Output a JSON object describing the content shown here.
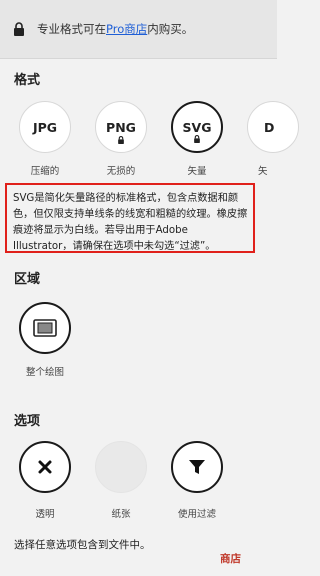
{
  "banner": {
    "text_before": "专业格式可在",
    "link_text": "Pro商店",
    "text_after": "内购买。"
  },
  "format_section": {
    "title": "格式",
    "options": [
      {
        "label": "JPG",
        "caption": "压缩的",
        "locked": false,
        "selected": false
      },
      {
        "label": "PNG",
        "caption": "无损的",
        "locked": true,
        "selected": false
      },
      {
        "label": "SVG",
        "caption": "矢量",
        "locked": true,
        "selected": true
      },
      {
        "label": "D",
        "caption": "矢",
        "locked": false,
        "selected": false
      }
    ],
    "description": "SVG是简化矢量路径的标准格式，包含点数据和颜色，但仅限支持单线条的线宽和粗糙的纹理。橡皮擦痕迹将显示为白线。若导出用于Adobe Illustrator，请确保在选项中未勾选“过滤”。"
  },
  "area_section": {
    "title": "区域",
    "options": [
      {
        "caption": "整个绘图",
        "icon": "canvas-icon"
      }
    ]
  },
  "options_section": {
    "title": "选项",
    "options": [
      {
        "caption": "透明",
        "icon": "close-icon"
      },
      {
        "caption": "纸张",
        "icon": "paper-icon"
      },
      {
        "caption": "使用过滤",
        "icon": "filter-icon"
      }
    ],
    "footer": "选择任意选项包含到文件中。"
  },
  "store_link": "商店",
  "colors": {
    "highlight_border": "#e0201b",
    "link": "#1f5fd6",
    "store": "#c0392b"
  }
}
